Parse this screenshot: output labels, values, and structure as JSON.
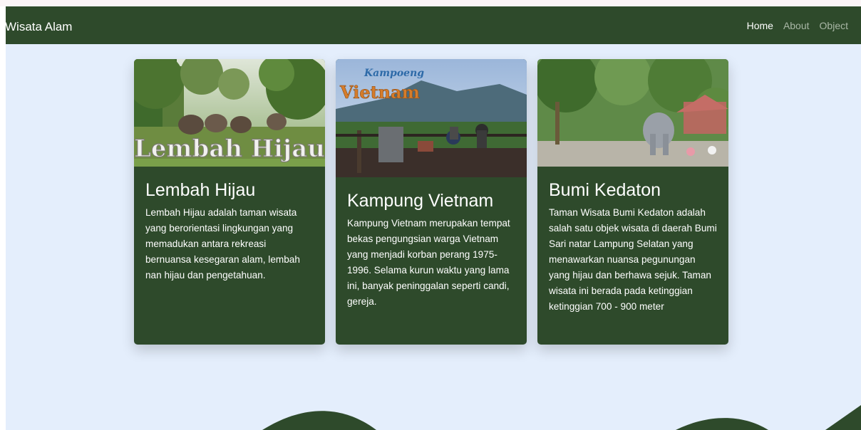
{
  "navbar": {
    "brand": "Wisata Alam",
    "links": [
      {
        "label": "Home",
        "active": true
      },
      {
        "label": "About",
        "active": false
      },
      {
        "label": "Object",
        "active": false
      }
    ]
  },
  "cards": [
    {
      "title": "Lembah Hijau",
      "image_text": "Lembah Hijau",
      "description": "Lembah Hijau adalah taman wisata yang berorientasi lingkungan yang memadukan antara rekreasi bernuansa kesegaran alam, lembah nan hijau dan pengetahuan."
    },
    {
      "title": "Kampung Vietnam",
      "image_text_top": "Kampoeng",
      "image_text_bottom": "Vietnam",
      "description": "Kampung Vietnam merupakan tempat bekas pengungsian warga Vietnam yang menjadi korban perang 1975-1996. Selama kurun waktu yang lama ini, banyak peninggalan seperti candi, gereja."
    },
    {
      "title": "Bumi Kedaton",
      "description": "Taman Wisata Bumi Kedaton adalah salah satu objek wisata di daerah Bumi Sari natar Lampung Selatan yang menawarkan nuansa pegunungan yang hijau dan berhawa sejuk. Taman wisata ini berada pada ketinggian ketinggian 700 - 900 meter"
    }
  ],
  "colors": {
    "navbar_bg": "#2e4a2b",
    "page_bg": "#e4eefc",
    "card_bg": "#2e4a2b",
    "nav_link_inactive": "#a9b7a6"
  }
}
